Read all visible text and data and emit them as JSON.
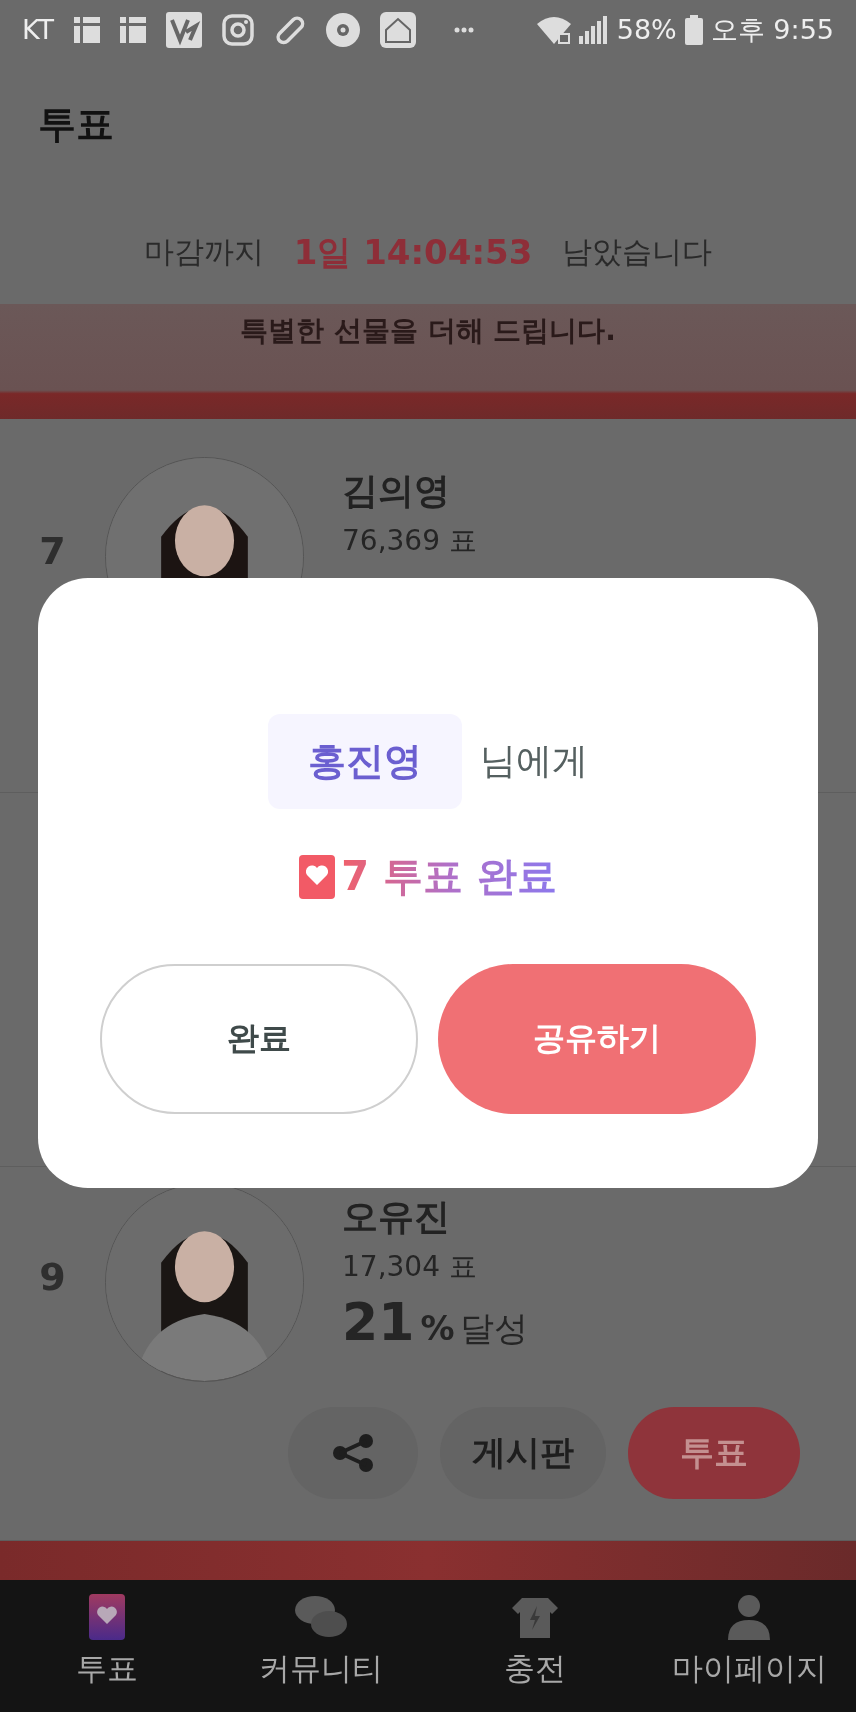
{
  "status_bar": {
    "carrier": "KT",
    "battery": "58%",
    "time": "오후 9:55"
  },
  "header": {
    "title": "투표"
  },
  "countdown": {
    "prefix": "마감까지",
    "remaining": "1일 14:04:53",
    "suffix": "남았습니다"
  },
  "banner": {
    "text": "특별한 선물을 더해 드립니다."
  },
  "candidates": [
    {
      "rank": "7",
      "name": "김의영",
      "votes": "76,369 표"
    },
    {
      "rank": "9",
      "name": "오유진",
      "votes": "17,304 표",
      "percent": "21",
      "percent_unit": "%",
      "achieved": "달성",
      "board_button": "게시판",
      "vote_button": "투표"
    }
  ],
  "dialog": {
    "recipient": "홍진영",
    "recipient_suffix": "님에게",
    "result": "7 투표 완료",
    "buttons": [
      {
        "label": "완료",
        "kind": "outline"
      },
      {
        "label": "공유하기",
        "kind": "filled"
      }
    ]
  },
  "bottom_nav": [
    {
      "label": "투표",
      "selected": true
    },
    {
      "label": "커뮤니티",
      "selected": false
    },
    {
      "label": "충전",
      "selected": false
    },
    {
      "label": "마이페이지",
      "selected": false
    }
  ]
}
